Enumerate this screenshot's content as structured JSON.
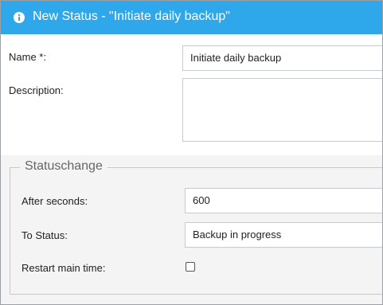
{
  "dialog": {
    "title": "New Status - \"Initiate daily backup\"",
    "accent_color": "#2ea8eb",
    "icon": "info-icon"
  },
  "form": {
    "name_label": "Name *:",
    "name_value": "Initiate daily backup",
    "description_label": "Description:",
    "description_value": ""
  },
  "statuschange": {
    "legend": "Statuschange",
    "after_seconds_label": "After seconds:",
    "after_seconds_value": "600",
    "to_status_label": "To Status:",
    "to_status_value": "Backup in progress",
    "restart_label": "Restart main time:",
    "restart_checked": false
  }
}
